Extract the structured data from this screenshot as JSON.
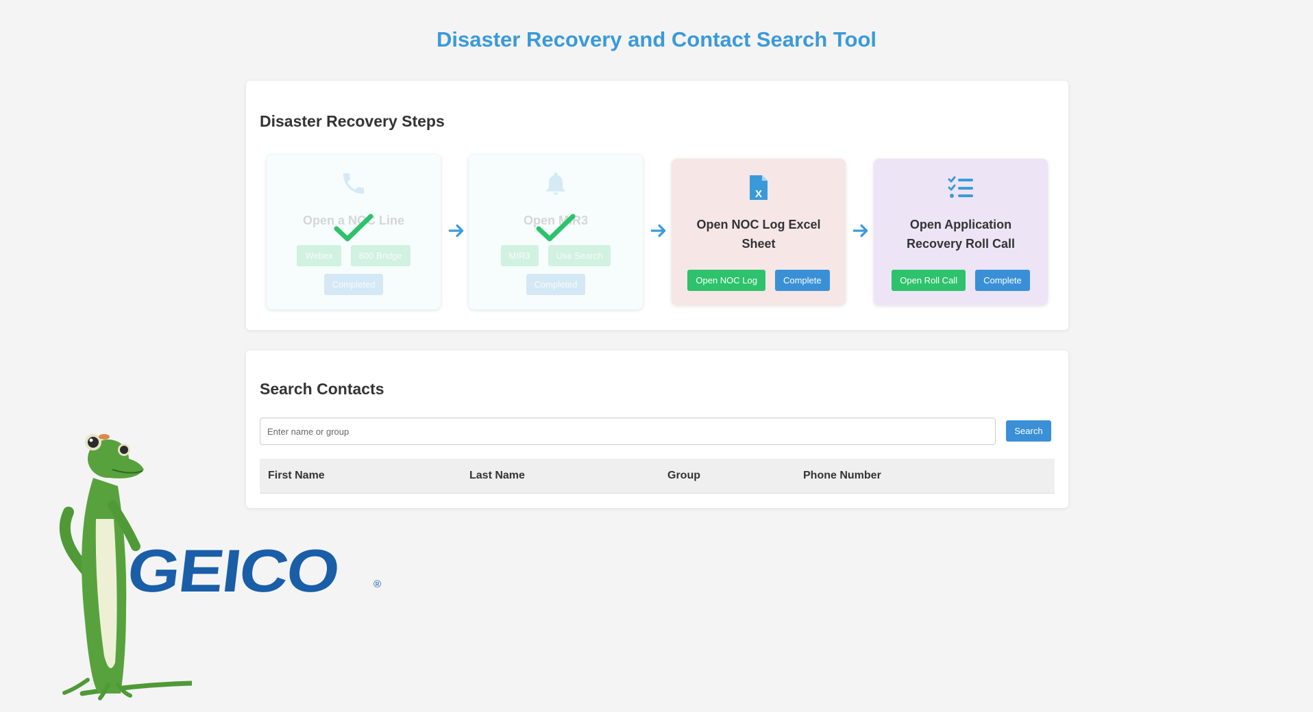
{
  "page": {
    "title": "Disaster Recovery and Contact Search Tool"
  },
  "steps_section": {
    "heading": "Disaster Recovery Steps",
    "steps": [
      {
        "title": "Open a NOC Line",
        "icon": "phone-icon",
        "status": "completed",
        "buttons": [
          "Webex",
          "800 Bridge"
        ],
        "status_label": "Completed"
      },
      {
        "title": "Open MIR3",
        "icon": "bell-icon",
        "status": "completed",
        "buttons": [
          "MIR3",
          "Use Search"
        ],
        "status_label": "Completed"
      },
      {
        "title": "Open NOC Log Excel Sheet",
        "icon": "excel-file-icon",
        "status": "active",
        "buttons": [
          "Open NOC Log",
          "Complete"
        ]
      },
      {
        "title": "Open Application Recovery Roll Call",
        "icon": "checklist-icon",
        "status": "active",
        "buttons": [
          "Open Roll Call",
          "Complete"
        ]
      }
    ]
  },
  "search_section": {
    "heading": "Search Contacts",
    "placeholder": "Enter name or group",
    "value": "",
    "button": "Search",
    "columns": [
      "First Name",
      "Last Name",
      "Group",
      "Phone Number"
    ],
    "rows": []
  },
  "branding": {
    "logo_text": "GEICO",
    "registered_mark": "®",
    "mascot": "gecko-mascot"
  },
  "colors": {
    "title": "#3a9ad9",
    "green": "#2dc26b",
    "blue": "#3a90d6",
    "pink": "#f6e6e6",
    "purple": "#ede4f6"
  }
}
